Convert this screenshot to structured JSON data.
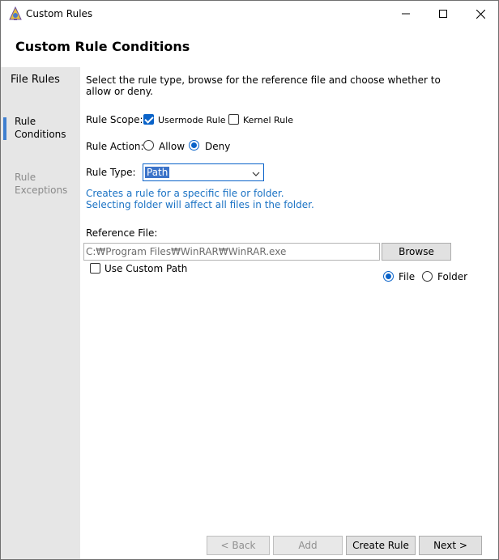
{
  "window": {
    "title": "Custom Rules",
    "icon": "app-logo-icon"
  },
  "header": {
    "title": "Custom Rule Conditions"
  },
  "sidebar": {
    "items": [
      {
        "label": "File Rules",
        "state": "normal"
      },
      {
        "label": "Rule\nConditions",
        "state": "selected"
      },
      {
        "label": "Rule\nExceptions",
        "state": "disabled"
      }
    ],
    "accent_color": "#3f7fd0"
  },
  "main": {
    "description": "Select the rule type, browse for the reference file and choose whether to allow or deny.",
    "rule_scope": {
      "label": "Rule Scope:",
      "options": [
        {
          "label": "Usermode Rule",
          "checked": true
        },
        {
          "label": "Kernel Rule",
          "checked": false
        }
      ]
    },
    "rule_action": {
      "label": "Rule Action:",
      "options": [
        {
          "label": "Allow",
          "selected": false
        },
        {
          "label": "Deny",
          "selected": true
        }
      ]
    },
    "rule_type": {
      "label": "Rule Type:",
      "value": "Path"
    },
    "hint": "Creates a rule for a specific file or folder.\nSelecting folder will affect all files in the folder.",
    "reference_file": {
      "label": "Reference File:",
      "value": "C:₩Program Files₩WinRAR₩WinRAR.exe",
      "browse_label": "Browse"
    },
    "use_custom_path": {
      "label": "Use Custom Path",
      "checked": false
    },
    "target_kind": {
      "options": [
        {
          "label": "File",
          "selected": true
        },
        {
          "label": "Folder",
          "selected": false
        }
      ]
    }
  },
  "footer": {
    "back_label": "< Back",
    "add_label": "Add",
    "create_label": "Create Rule",
    "next_label": "Next >"
  },
  "colors": {
    "accent": "#0a63c9",
    "hint_text": "#1a72c4",
    "sidebar_bg": "#e6e6e6"
  }
}
